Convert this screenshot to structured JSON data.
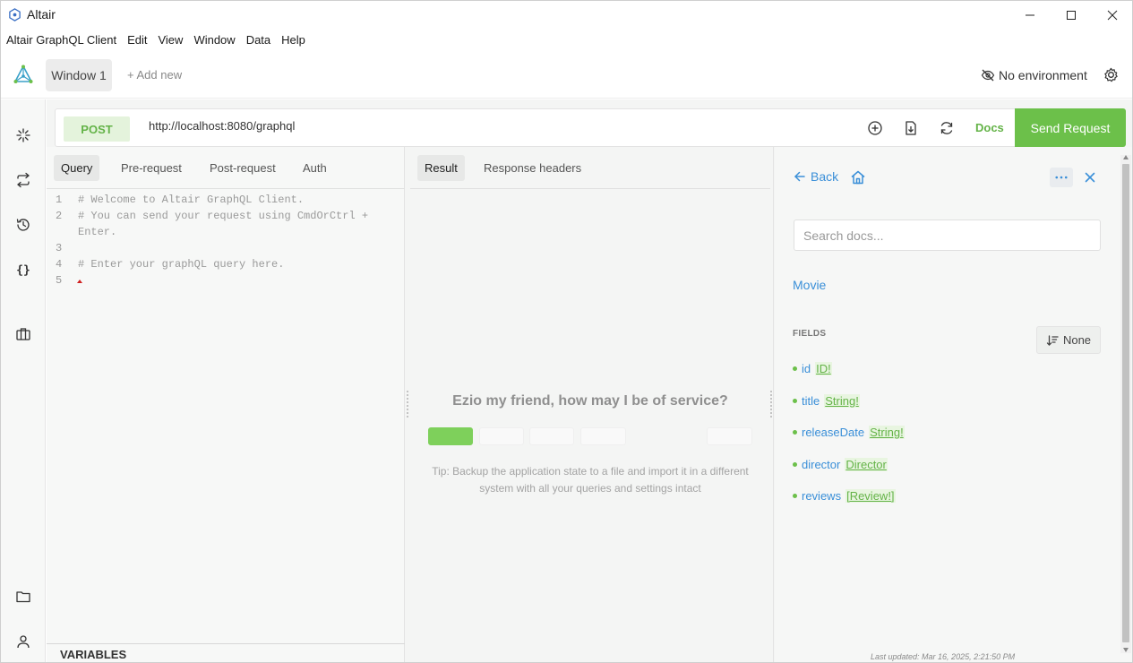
{
  "window": {
    "title": "Altair",
    "controls": [
      "minimize-icon",
      "maximize-icon",
      "close-icon"
    ]
  },
  "menu": {
    "items": [
      "Altair GraphQL Client",
      "Edit",
      "View",
      "Window",
      "Data",
      "Help"
    ]
  },
  "header": {
    "tab_label": "Window 1",
    "add_new_label": "+ Add new",
    "environment_label": "No environment"
  },
  "sidebar": {
    "icons": [
      "loading-icon",
      "swap-icon",
      "history-icon",
      "braces-icon",
      "toolbox-icon",
      "folder-icon",
      "user-icon"
    ]
  },
  "request": {
    "method": "POST",
    "url": "http://localhost:8080/graphql",
    "docs_label": "Docs",
    "send_label": "Send Request"
  },
  "query_tabs": [
    "Query",
    "Pre-request",
    "Post-request",
    "Auth"
  ],
  "editor": {
    "lines": [
      {
        "n": "1",
        "text": "# Welcome to Altair GraphQL Client."
      },
      {
        "n": "2",
        "text": "# You can send your request using CmdOrCtrl +"
      },
      {
        "n": "",
        "text": "Enter."
      },
      {
        "n": "3",
        "text": ""
      },
      {
        "n": "4",
        "text": "# Enter your graphQL query here."
      },
      {
        "n": "5",
        "text": ""
      }
    ]
  },
  "variables_label": "VARIABLES",
  "result_tabs": [
    "Result",
    "Response headers"
  ],
  "result": {
    "empty_title": "Ezio my friend, how may I be of service?",
    "tip": "Tip: Backup the application state to a file and import it in a different system with all your queries and settings intact"
  },
  "docs": {
    "back_label": "Back",
    "search_placeholder": "Search docs...",
    "type_name": "Movie",
    "fields_label": "FIELDS",
    "sort_label": "None",
    "fields": [
      {
        "name": "id",
        "type": "ID!"
      },
      {
        "name": "title",
        "type": "String!"
      },
      {
        "name": "releaseDate",
        "type": "String!"
      },
      {
        "name": "director",
        "type": "Director"
      },
      {
        "name": "reviews",
        "type": "[Review!]"
      }
    ],
    "last_updated": "Last updated: Mar 16, 2025, 2:21:50 PM"
  },
  "colors": {
    "accent_green": "#6cc04a",
    "link_blue": "#3a8fd8"
  }
}
